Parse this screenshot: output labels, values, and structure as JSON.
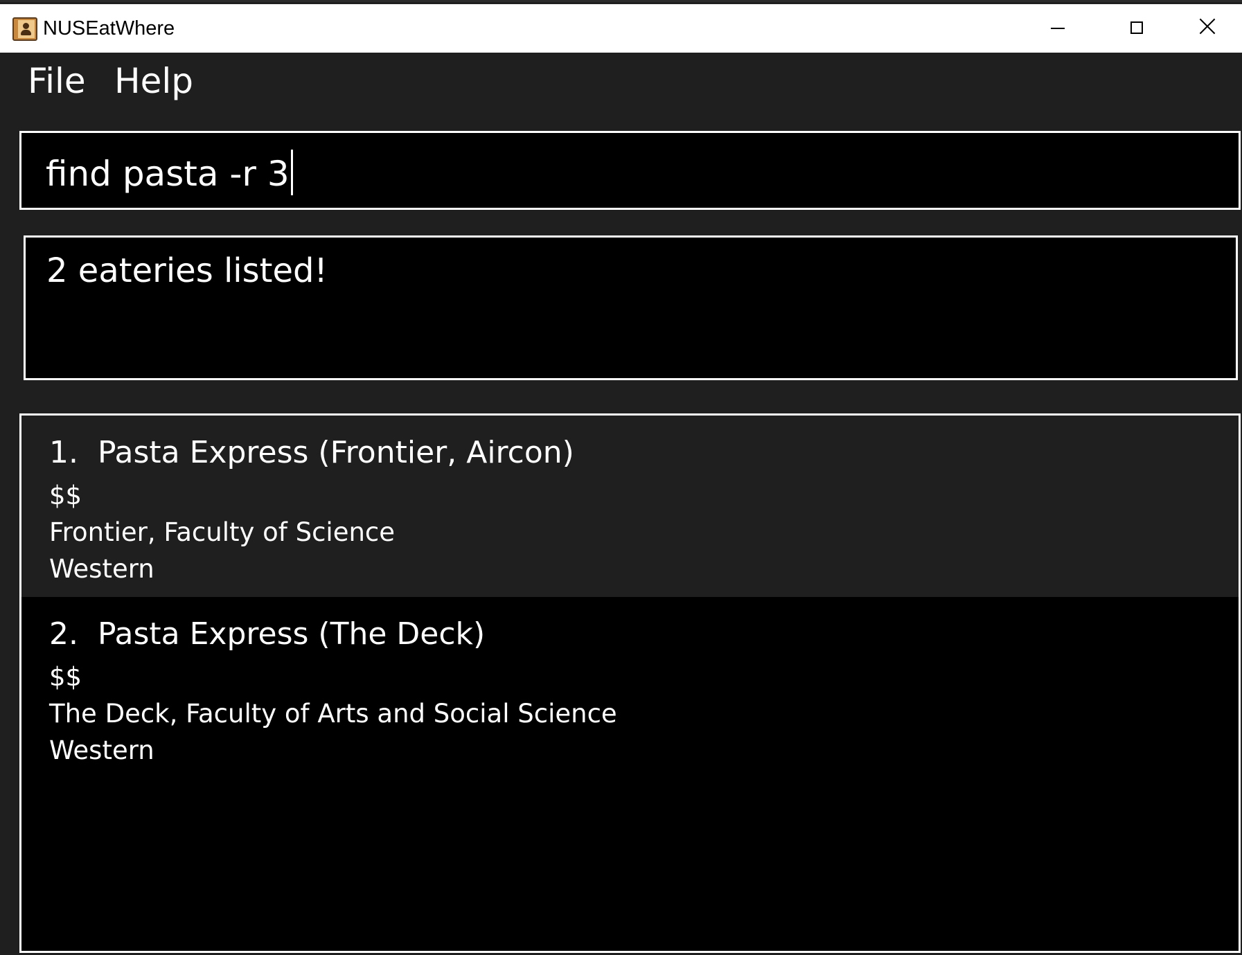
{
  "window": {
    "title": "NUSEatWhere",
    "icon": "address-book-icon"
  },
  "menu": {
    "file_label": "File",
    "help_label": "Help"
  },
  "command_box": {
    "value": "find pasta -r 3"
  },
  "result_display": {
    "text": "2 eateries listed!"
  },
  "eateries": [
    {
      "index": "1.",
      "name": "Pasta Express (Frontier, Aircon)",
      "price": "$$",
      "location": "Frontier, Faculty of Science",
      "cuisine": "Western"
    },
    {
      "index": "2.",
      "name": "Pasta Express (The Deck)",
      "price": "$$",
      "location": "The Deck, Faculty of Arts and Social Science",
      "cuisine": "Western"
    }
  ],
  "colors": {
    "background": "#1f1f1f",
    "panel": "#000000",
    "text": "#ffffff",
    "border": "#ffffff"
  }
}
